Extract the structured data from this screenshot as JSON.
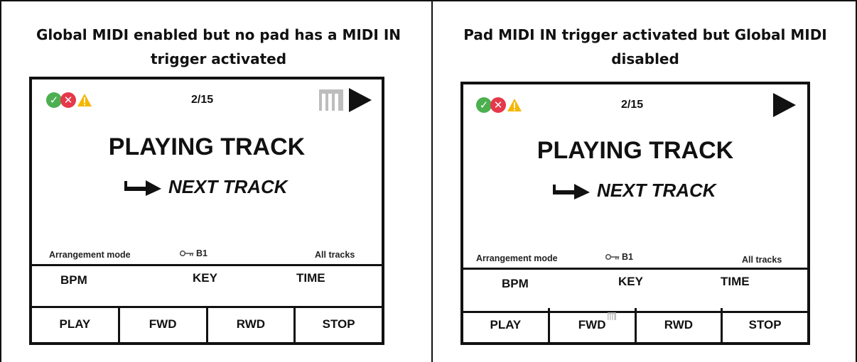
{
  "panels": [
    {
      "title": "Global MIDI enabled but no pad has a MIDI IN trigger activated",
      "screen": {
        "track_count": "2/15",
        "playing_label": "PLAYING TRACK",
        "next_label": "NEXT TRACK",
        "mode_label": "Arrangement mode",
        "key_label": "B1",
        "tracks_label": "All tracks",
        "info": {
          "bpm": "BPM",
          "key": "KEY",
          "time": "TIME"
        },
        "buttons": [
          "PLAY",
          "FWD",
          "RWD",
          "STOP"
        ],
        "midi_icon_in_status": true,
        "midi_icon_on_fwd": false
      }
    },
    {
      "title": "Pad MIDI IN trigger activated but Global MIDI disabled",
      "screen": {
        "track_count": "2/15",
        "playing_label": "PLAYING TRACK",
        "next_label": "NEXT TRACK",
        "mode_label": "Arrangement mode",
        "key_label": "B1",
        "tracks_label": "All tracks",
        "info": {
          "bpm": "BPM",
          "key": "KEY",
          "time": "TIME"
        },
        "buttons": [
          "PLAY",
          "FWD",
          "RWD",
          "STOP"
        ],
        "midi_icon_in_status": false,
        "midi_icon_on_fwd": true
      }
    }
  ],
  "colors": {
    "ok": "#4caf50",
    "error": "#e5384a",
    "warning": "#f5b700",
    "midi_icon": "#bdbdbd"
  },
  "icons": [
    "check-icon",
    "error-icon",
    "warning-icon",
    "midi-icon",
    "play-icon",
    "arrow-right-icon",
    "key-icon"
  ]
}
